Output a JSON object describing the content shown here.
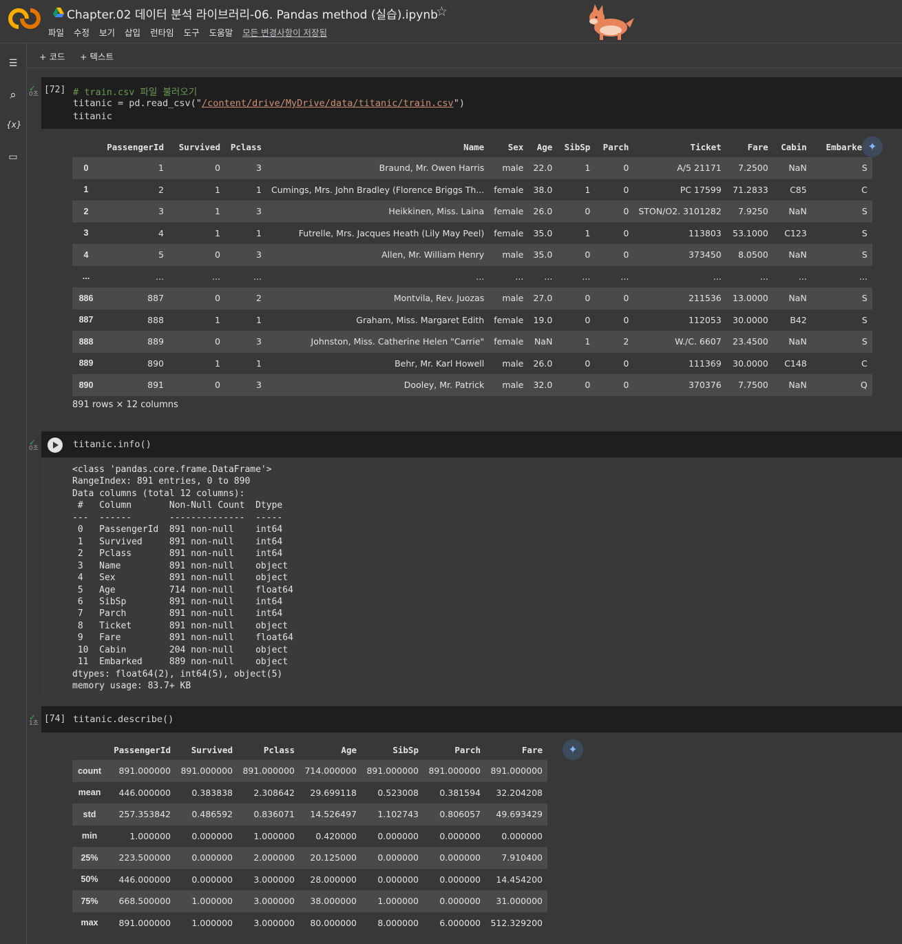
{
  "header": {
    "title": "Chapter.02 데이터 분석 라이브러리-06. Pandas method (실습).ipynb",
    "menu": [
      "파일",
      "수정",
      "보기",
      "삽입",
      "런타임",
      "도구",
      "도움말"
    ],
    "save_status": "모든 변경사항이 저장됨"
  },
  "toolbar": {
    "add_code": "+ 코드",
    "add_text": "+ 텍스트"
  },
  "rail": {
    "toc": "☰",
    "search": "⌕",
    "variables": "{x}",
    "files": "▭"
  },
  "cell1": {
    "exec_count": "[72]",
    "status_time": "0초",
    "code": {
      "comment": "# train.csv 파일 불러오기",
      "line2_pre": "titanic = pd.read_csv(\"",
      "line2_str": "/content/drive/MyDrive/data/titanic/train.csv",
      "line2_post": "\")",
      "line3": "titanic"
    },
    "table": {
      "columns": [
        "",
        "PassengerId",
        "Survived",
        "Pclass",
        "Name",
        "Sex",
        "Age",
        "SibSp",
        "Parch",
        "Ticket",
        "Fare",
        "Cabin",
        "Embarked"
      ],
      "rows": [
        [
          "0",
          "1",
          "0",
          "3",
          "Braund, Mr. Owen Harris",
          "male",
          "22.0",
          "1",
          "0",
          "A/5 21171",
          "7.2500",
          "NaN",
          "S"
        ],
        [
          "1",
          "2",
          "1",
          "1",
          "Cumings, Mrs. John Bradley (Florence Briggs Th...",
          "female",
          "38.0",
          "1",
          "0",
          "PC 17599",
          "71.2833",
          "C85",
          "C"
        ],
        [
          "2",
          "3",
          "1",
          "3",
          "Heikkinen, Miss. Laina",
          "female",
          "26.0",
          "0",
          "0",
          "STON/O2. 3101282",
          "7.9250",
          "NaN",
          "S"
        ],
        [
          "3",
          "4",
          "1",
          "1",
          "Futrelle, Mrs. Jacques Heath (Lily May Peel)",
          "female",
          "35.0",
          "1",
          "0",
          "113803",
          "53.1000",
          "C123",
          "S"
        ],
        [
          "4",
          "5",
          "0",
          "3",
          "Allen, Mr. William Henry",
          "male",
          "35.0",
          "0",
          "0",
          "373450",
          "8.0500",
          "NaN",
          "S"
        ],
        [
          "...",
          "...",
          "...",
          "...",
          "...",
          "...",
          "...",
          "...",
          "...",
          "...",
          "...",
          "...",
          "..."
        ],
        [
          "886",
          "887",
          "0",
          "2",
          "Montvila, Rev. Juozas",
          "male",
          "27.0",
          "0",
          "0",
          "211536",
          "13.0000",
          "NaN",
          "S"
        ],
        [
          "887",
          "888",
          "1",
          "1",
          "Graham, Miss. Margaret Edith",
          "female",
          "19.0",
          "0",
          "0",
          "112053",
          "30.0000",
          "B42",
          "S"
        ],
        [
          "888",
          "889",
          "0",
          "3",
          "Johnston, Miss. Catherine Helen \"Carrie\"",
          "female",
          "NaN",
          "1",
          "2",
          "W./C. 6607",
          "23.4500",
          "NaN",
          "S"
        ],
        [
          "889",
          "890",
          "1",
          "1",
          "Behr, Mr. Karl Howell",
          "male",
          "26.0",
          "0",
          "0",
          "111369",
          "30.0000",
          "C148",
          "C"
        ],
        [
          "890",
          "891",
          "0",
          "3",
          "Dooley, Mr. Patrick",
          "male",
          "32.0",
          "0",
          "0",
          "370376",
          "7.7500",
          "NaN",
          "Q"
        ]
      ],
      "shape": "891 rows × 12 columns"
    }
  },
  "cell2": {
    "status_time": "0초",
    "code": "titanic.info()",
    "output": "<class 'pandas.core.frame.DataFrame'>\nRangeIndex: 891 entries, 0 to 890\nData columns (total 12 columns):\n #   Column       Non-Null Count  Dtype  \n---  ------       --------------  -----  \n 0   PassengerId  891 non-null    int64  \n 1   Survived     891 non-null    int64  \n 2   Pclass       891 non-null    int64  \n 3   Name         891 non-null    object \n 4   Sex          891 non-null    object \n 5   Age          714 non-null    float64\n 6   SibSp        891 non-null    int64  \n 7   Parch        891 non-null    int64  \n 8   Ticket       891 non-null    object \n 9   Fare         891 non-null    float64\n 10  Cabin        204 non-null    object \n 11  Embarked     889 non-null    object \ndtypes: float64(2), int64(5), object(5)\nmemory usage: 83.7+ KB"
  },
  "cell3": {
    "exec_count": "[74]",
    "status_time": "1초",
    "code": "titanic.describe()",
    "table": {
      "columns": [
        "",
        "PassengerId",
        "Survived",
        "Pclass",
        "Age",
        "SibSp",
        "Parch",
        "Fare"
      ],
      "rows": [
        [
          "count",
          "891.000000",
          "891.000000",
          "891.000000",
          "714.000000",
          "891.000000",
          "891.000000",
          "891.000000"
        ],
        [
          "mean",
          "446.000000",
          "0.383838",
          "2.308642",
          "29.699118",
          "0.523008",
          "0.381594",
          "32.204208"
        ],
        [
          "std",
          "257.353842",
          "0.486592",
          "0.836071",
          "14.526497",
          "1.102743",
          "0.806057",
          "49.693429"
        ],
        [
          "min",
          "1.000000",
          "0.000000",
          "1.000000",
          "0.420000",
          "0.000000",
          "0.000000",
          "0.000000"
        ],
        [
          "25%",
          "223.500000",
          "0.000000",
          "2.000000",
          "20.125000",
          "0.000000",
          "0.000000",
          "7.910400"
        ],
        [
          "50%",
          "446.000000",
          "0.000000",
          "3.000000",
          "28.000000",
          "0.000000",
          "0.000000",
          "14.454200"
        ],
        [
          "75%",
          "668.500000",
          "1.000000",
          "3.000000",
          "38.000000",
          "1.000000",
          "0.000000",
          "31.000000"
        ],
        [
          "max",
          "891.000000",
          "1.000000",
          "3.000000",
          "80.000000",
          "8.000000",
          "6.000000",
          "512.329200"
        ]
      ]
    }
  }
}
